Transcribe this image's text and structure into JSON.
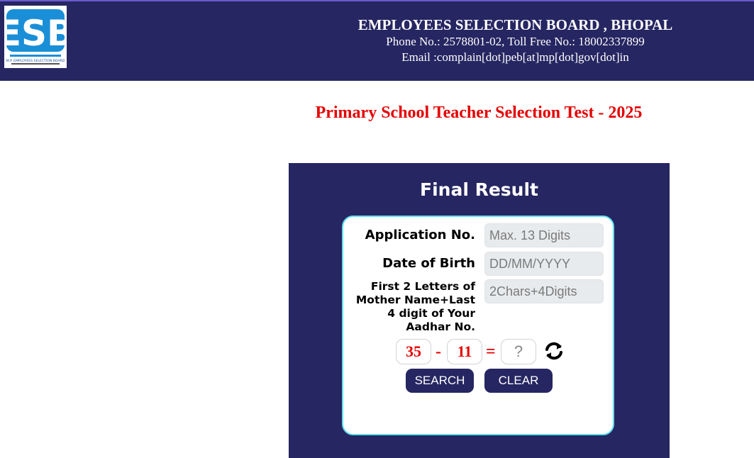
{
  "header": {
    "logo_text": "ESB",
    "logo_caption": "M.P. EMPLOYEES SELECTION BOARD",
    "org_name": "EMPLOYEES SELECTION BOARD , BHOPAL",
    "phone_line": "Phone No.: 2578801-02, Toll Free No.: 18002337899",
    "email_line": "Email :complain[dot]peb[at]mp[dot]gov[dot]in"
  },
  "page_title": "Primary School Teacher Selection Test - 2025",
  "form": {
    "title": "Final Result",
    "application_label": "Application No.",
    "application_placeholder": "Max. 13 Digits",
    "dob_label": "Date of Birth",
    "dob_placeholder": "DD/MM/YYYY",
    "mother_label": "First 2 Letters of Mother Name+Last 4 digit of Your Aadhar No.",
    "mother_placeholder": "2Chars+4Digits",
    "captcha": {
      "num1": "35",
      "operator": "-",
      "num2": "11",
      "equals": "=",
      "answer_placeholder": "?"
    },
    "search_label": "SEARCH",
    "clear_label": "CLEAR"
  },
  "colors": {
    "navy": "#262662",
    "accent_red": "#e60000",
    "card_border": "#5fe0ee",
    "logo_blue": "#1a8fd8"
  }
}
